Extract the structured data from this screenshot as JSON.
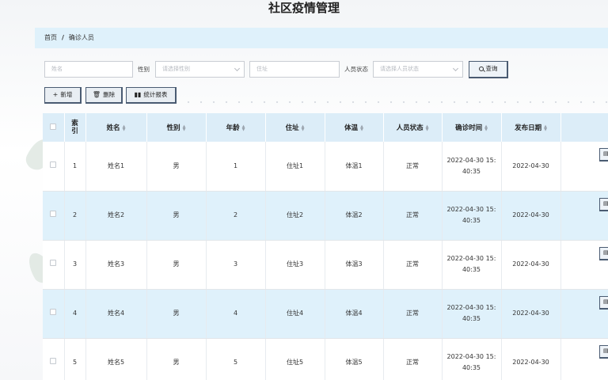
{
  "page_title": "社区疫情管理",
  "breadcrumb": {
    "home": "首页",
    "separator": "/",
    "current": "确诊人员"
  },
  "search": {
    "name_placeholder": "姓名",
    "gender_label": "性别",
    "gender_placeholder": "请选择性别",
    "address_placeholder": "住址",
    "status_label": "人员状态",
    "status_placeholder": "请选择人员状态",
    "query_label": "查询"
  },
  "toolbar": {
    "add_label": "新增",
    "delete_label": "删除",
    "report_label": "统计报表"
  },
  "table": {
    "headers": {
      "index": "索引",
      "name": "姓名",
      "gender": "性别",
      "age": "年龄",
      "address": "住址",
      "temperature": "体温",
      "status": "人员状态",
      "diagnosis_time": "确诊时间",
      "publish_date": "发布日期"
    },
    "detail_label": "详情",
    "rows": [
      {
        "index": "1",
        "name": "姓名1",
        "gender": "男",
        "age": "1",
        "address": "住址1",
        "temperature": "体温1",
        "status": "正常",
        "diagnosis_time": "2022-04-30 15:40:35",
        "publish_date": "2022-04-30"
      },
      {
        "index": "2",
        "name": "姓名2",
        "gender": "男",
        "age": "2",
        "address": "住址2",
        "temperature": "体温2",
        "status": "正常",
        "diagnosis_time": "2022-04-30 15:40:35",
        "publish_date": "2022-04-30"
      },
      {
        "index": "3",
        "name": "姓名3",
        "gender": "男",
        "age": "3",
        "address": "住址3",
        "temperature": "体温3",
        "status": "正常",
        "diagnosis_time": "2022-04-30 15:40:35",
        "publish_date": "2022-04-30"
      },
      {
        "index": "4",
        "name": "姓名4",
        "gender": "男",
        "age": "4",
        "address": "住址4",
        "temperature": "体温4",
        "status": "正常",
        "diagnosis_time": "2022-04-30 15:40:35",
        "publish_date": "2022-04-30"
      },
      {
        "index": "5",
        "name": "姓名5",
        "gender": "男",
        "age": "5",
        "address": "住址5",
        "temperature": "体温5",
        "status": "正常",
        "diagnosis_time": "2022-04-30 15:40:35",
        "publish_date": "2022-04-30"
      }
    ]
  },
  "colors": {
    "header_bg": "#dcedf8",
    "row_alt_bg": "#dff1fb",
    "button_border": "#4a5b72"
  }
}
